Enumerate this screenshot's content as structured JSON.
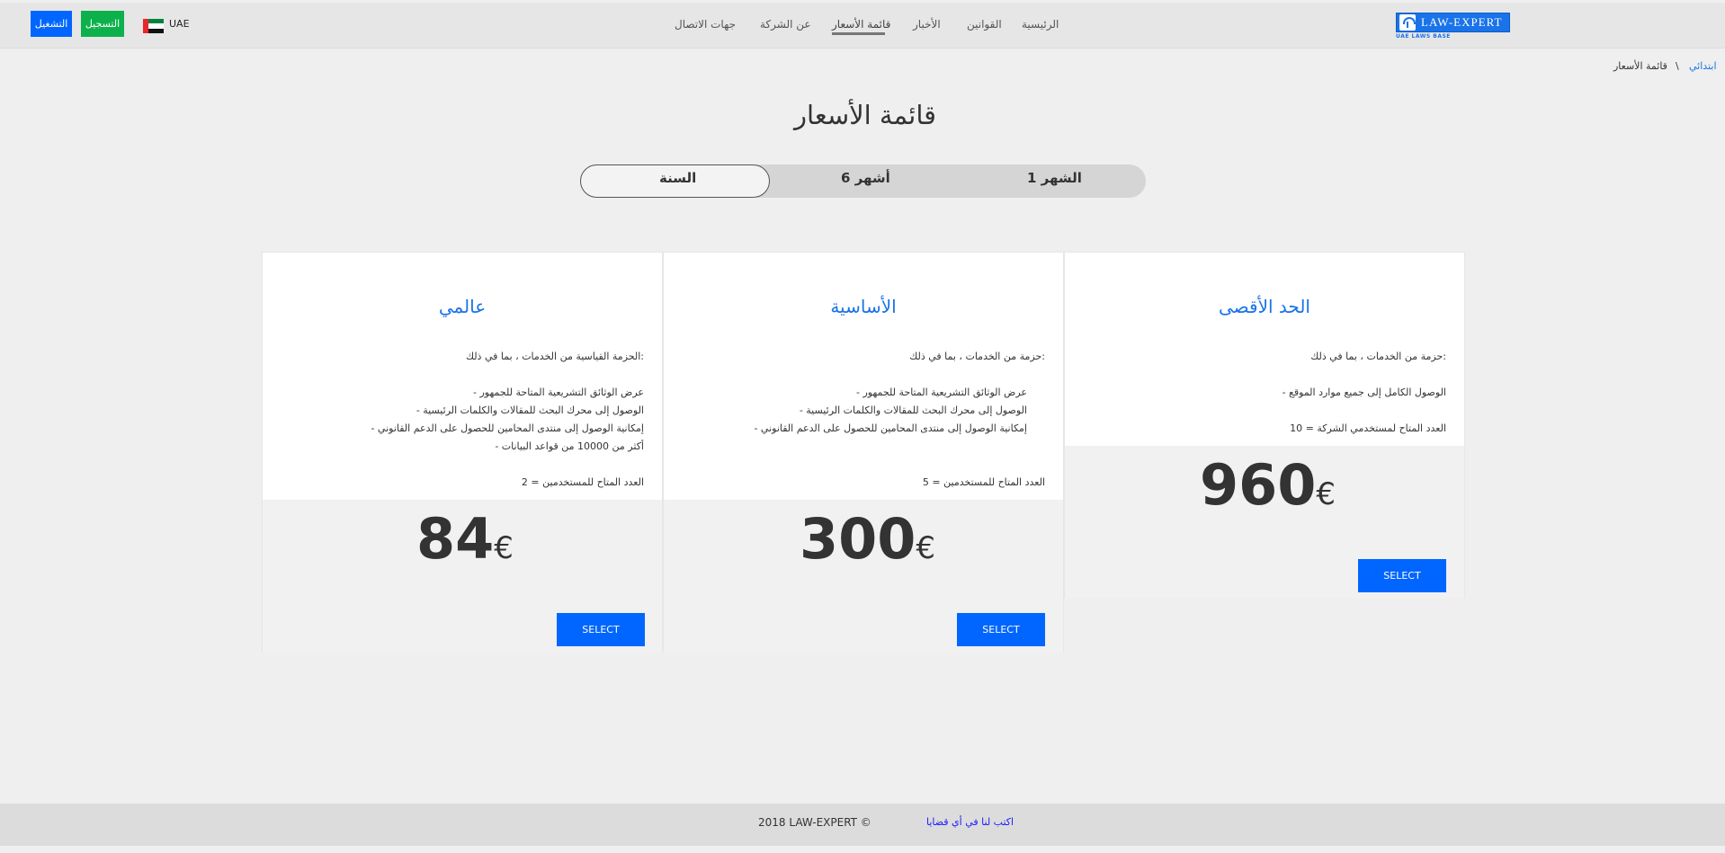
{
  "header": {
    "login_label": "التشغيل",
    "register_label": "التسجيل",
    "country": "UAE",
    "nav": [
      {
        "label": "الرئيسية"
      },
      {
        "label": "القوانين"
      },
      {
        "label": "الأخبار"
      },
      {
        "label": "قائمة الأسعار"
      },
      {
        "label": "عن الشركة"
      },
      {
        "label": "جهات الاتصال"
      }
    ],
    "logo_text": "LAW-EXPERT",
    "logo_sub": "UAE LAWS BASE"
  },
  "breadcrumb": {
    "home": "ابتدائي",
    "separator": "\\",
    "current": "قائمة الأسعار"
  },
  "page_title": "قائمة الأسعار",
  "periods": [
    {
      "label": "الشهر 1"
    },
    {
      "label": "أشهر 6"
    },
    {
      "label": "السنة"
    }
  ],
  "selected_period": "السنة",
  "plans": [
    {
      "title": "الحد الأقصى",
      "intro": "حزمة من الخدمات ، بما في ذلك:",
      "features": [
        "- الوصول الكامل إلى جميع موارد الموقع"
      ],
      "users": "العدد المتاح لمستخدمي الشركة = 10",
      "price": "960",
      "currency": "€",
      "button": "SELECT"
    },
    {
      "title": "الأساسية",
      "intro": "حزمة من الخدمات ، بما في ذلك:",
      "features": [
        "- عرض الوثائق التشريعية المتاحة للجمهور",
        "- الوصول إلى محرك البحث للمقالات والكلمات الرئيسية",
        "- إمكانية الوصول إلى منتدى المحامين للحصول على الدعم القانوني"
      ],
      "users": "العدد المتاح للمستخدمين = 5",
      "price": "300",
      "currency": "€",
      "button": "SELECT"
    },
    {
      "title": "عالمي",
      "intro": "الحزمة القياسية من الخدمات ، بما في ذلك:",
      "features": [
        "- عرض الوثائق التشريعية المتاحة للجمهور",
        "- الوصول إلى محرك البحث للمقالات والكلمات الرئيسية",
        "- إمكانية الوصول إلى منتدى المحامين للحصول على الدعم القانوني",
        "- أكثر من 10000 من قواعد البيانات"
      ],
      "users": "العدد المتاح للمستخدمين = 2",
      "price": "84",
      "currency": "€",
      "button": "SELECT"
    }
  ],
  "footer": {
    "copyright": "2018 LAW-EXPERT ©",
    "contact_link": "اكتب لنا في أي قضايا"
  },
  "colors": {
    "primary": "#0066ff",
    "register": "#0db14b",
    "accent_text": "#1a73e8",
    "background": "#efefef"
  }
}
